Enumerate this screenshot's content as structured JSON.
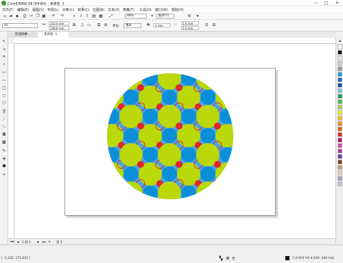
{
  "window": {
    "title": "CorelDRAW X8 (64-Bit) - 未命名 -1",
    "minimize": "—",
    "maximize": "□",
    "close": "✕"
  },
  "menu": [
    "文件(F)",
    "编辑(E)",
    "视图(V)",
    "布局(L)",
    "对象(C)",
    "效果(C)",
    "位图(B)",
    "文本(X)",
    "表格(T)",
    "工具(O)",
    "窗口(W)",
    "帮助(H)"
  ],
  "standard_toolbar": {
    "zoom": "99%",
    "snap_label": "贴齐(T)"
  },
  "property_bar": {
    "page_size": "A5",
    "width": "210.0 mm",
    "height": "148.0 mm",
    "units_label": "单位:",
    "units": "毫米",
    "nudge": ".1 mm",
    "dup_x": "5.0 mm",
    "dup_y": "5.0 mm"
  },
  "tabs": {
    "welcome": "欢迎屏幕",
    "doc": "未命名 -1"
  },
  "doc_nav": {
    "page_count": "1 的 1",
    "page_tab": "页 1"
  },
  "status": {
    "coords": "( -1,222, 173.052 )",
    "fill": "C:0 M:0 Y:0 K:100 .200 mm",
    "outline_none": "无"
  },
  "palette_colors": [
    "#ffffff",
    "#000000",
    "#e6e6e6",
    "#cccccc",
    "#999999",
    "#00a0e0",
    "#2060c0",
    "#0050a0",
    "#80c0e0",
    "#00a070",
    "#40c040",
    "#a0d040",
    "#f0f000",
    "#f0c000",
    "#f09000",
    "#e06000",
    "#e02020",
    "#c00060",
    "#e040a0",
    "#a040a0",
    "#6040a0",
    "#804020",
    "#c0a080",
    "#e0d0c0",
    "#a0a0c0",
    "#c0c0e0"
  ],
  "circle_colors": {
    "background": "#4ea3dc",
    "big_green": "#bad80a",
    "mid_blue": "#0a8fd8",
    "small_red": "#e1262b"
  }
}
